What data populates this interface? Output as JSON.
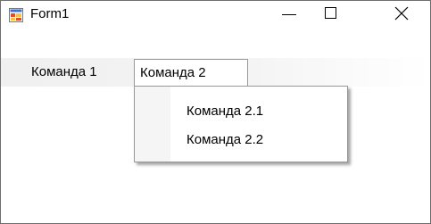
{
  "window": {
    "title": "Form1",
    "icon": "winforms-app-icon"
  },
  "caption_buttons": {
    "minimize_icon": "minimize-icon",
    "maximize_icon": "maximize-icon",
    "close_icon": "close-icon"
  },
  "menubar": {
    "items": [
      {
        "label": "Команда 1"
      },
      {
        "label": "Команда 2"
      }
    ]
  },
  "dropdown": {
    "items": [
      {
        "label": "Команда 2.1"
      },
      {
        "label": "Команда 2.2"
      }
    ]
  },
  "colors": {
    "window_border": "#6e6e6e",
    "menubar_bg": "#f0f0f0",
    "dropdown_border": "#979797",
    "text": "#000000"
  }
}
